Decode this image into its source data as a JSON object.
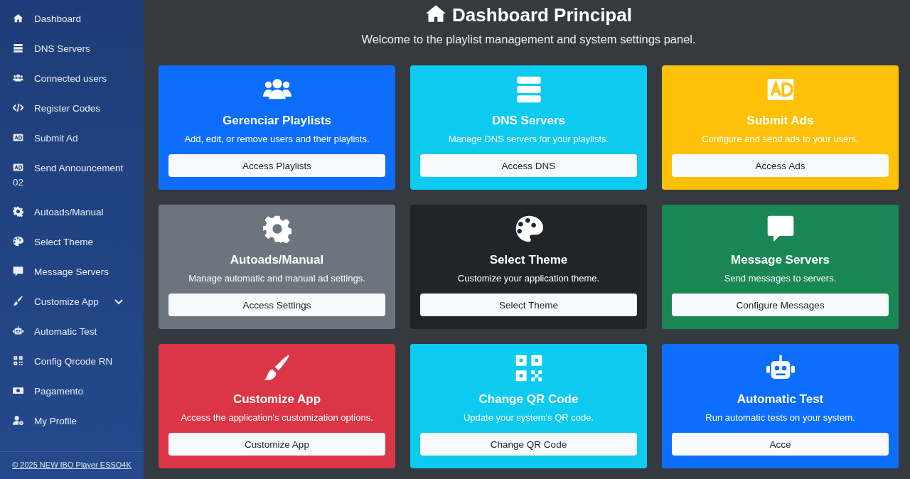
{
  "sidebar": {
    "items": [
      {
        "label": "Dashboard",
        "has_submenu": false
      },
      {
        "label": "DNS Servers",
        "has_submenu": false
      },
      {
        "label": "Connected users",
        "has_submenu": false
      },
      {
        "label": "Register Codes",
        "has_submenu": false
      },
      {
        "label": "Submit Ad",
        "has_submenu": false
      },
      {
        "label": "Send Announcement 02",
        "has_submenu": false
      },
      {
        "label": "Autoads/Manual",
        "has_submenu": false
      },
      {
        "label": "Select Theme",
        "has_submenu": false
      },
      {
        "label": "Message Servers",
        "has_submenu": false
      },
      {
        "label": "Customize App",
        "has_submenu": true
      },
      {
        "label": "Automatic Test",
        "has_submenu": false
      },
      {
        "label": "Config Qrcode RN",
        "has_submenu": false
      },
      {
        "label": "Pagamento",
        "has_submenu": false
      },
      {
        "label": "My Profile",
        "has_submenu": false
      }
    ],
    "footer": "© 2025 NEW IBO Player ESSO4K"
  },
  "header": {
    "title": "Dashboard Principal",
    "subtitle": "Welcome to the playlist management and system settings panel."
  },
  "cards": [
    {
      "title": "Gerenciar Playlists",
      "description": "Add, edit, or remove users and their playlists.",
      "button": "Access Playlists",
      "color": "#0d6efd"
    },
    {
      "title": "DNS Servers",
      "description": "Manage DNS servers for your playlists.",
      "button": "Access DNS",
      "color": "#0dcaf0"
    },
    {
      "title": "Submit Ads",
      "description": "Configure and send ads to your users.",
      "button": "Access Ads",
      "color": "#ffc107"
    },
    {
      "title": "Autoads/Manual",
      "description": "Manage automatic and manual ad settings.",
      "button": "Access Settings",
      "color": "#6c757d"
    },
    {
      "title": "Select Theme",
      "description": "Customize your application theme.",
      "button": "Select Theme",
      "color": "#212529"
    },
    {
      "title": "Message Servers",
      "description": "Send messages to servers.",
      "button": "Configure Messages",
      "color": "#198754"
    },
    {
      "title": "Customize App",
      "description": "Access the application's customization options.",
      "button": "Customize App",
      "color": "#dc3545"
    },
    {
      "title": "Change QR Code",
      "description": "Update your system's QR code.",
      "button": "Change QR Code",
      "color": "#0dcaf0"
    },
    {
      "title": "Automatic Test",
      "description": "Run automatic tests on your system.",
      "button": "Acce",
      "color": "#0d6efd"
    }
  ]
}
